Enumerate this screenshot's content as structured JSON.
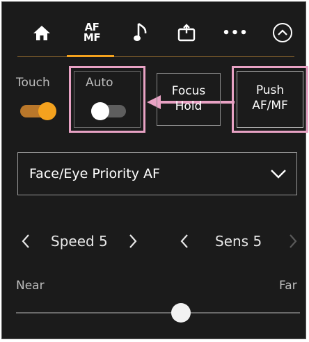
{
  "tabs": {
    "home": "home",
    "af_mf_line1": "AF",
    "af_mf_line2": "MF",
    "audio": "music-note",
    "assign": "assign",
    "more": "•••",
    "collapse": "chevron-up"
  },
  "focus_mode": {
    "touch_label": "Touch",
    "auto_label": "Auto",
    "focus_hold_line1": "Focus",
    "focus_hold_line2": "Hold",
    "push_line1": "Push",
    "push_line2": "AF/MF",
    "touch_on": true,
    "auto_on": false
  },
  "af_mode": {
    "selected": "Face/Eye Priority AF"
  },
  "speed": {
    "value": "Speed 5"
  },
  "sens": {
    "value": "Sens 5"
  },
  "focus_slider": {
    "near_label": "Near",
    "far_label": "Far",
    "position": 0.58
  },
  "colors": {
    "accent": "#f4a21e",
    "highlight": "#e8a2c4",
    "background": "#1b1b1b"
  }
}
